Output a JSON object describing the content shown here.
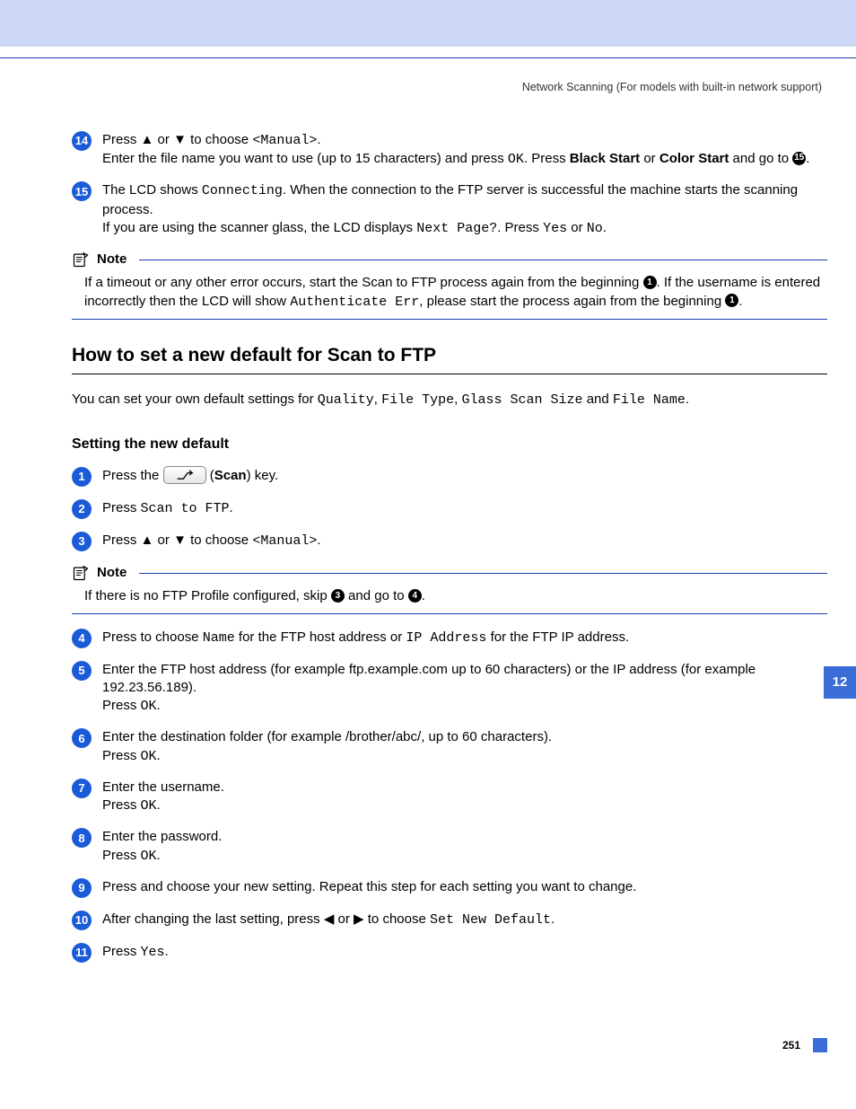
{
  "header": {
    "chapter_line": "Network Scanning (For models with built-in network support)"
  },
  "pre_steps": {
    "s14": {
      "num": "14",
      "t1a": "Press ",
      "t1b": " or ",
      "t1c": " to choose ",
      "t1_mono": "<Manual>",
      "t1d": ".",
      "t2a": "Enter the file name you want to use (up to 15 characters) and press ",
      "t2_mono": "OK",
      "t2b": ". Press ",
      "t2_bold1": "Black Start",
      "t2c": " or ",
      "t2_bold2": "Color Start",
      "t2d": " and go to ",
      "ref": "15",
      "t2e": "."
    },
    "s15": {
      "num": "15",
      "t1a": "The LCD shows ",
      "t1_mono": "Connecting",
      "t1b": ". When the connection to the FTP server is successful the machine starts the scanning process.",
      "t2a": "If you are using the scanner glass, the LCD displays ",
      "t2_mono1": "Next Page?",
      "t2b": ". Press ",
      "t2_mono2": "Yes",
      "t2c": " or ",
      "t2_mono3": "No",
      "t2d": "."
    }
  },
  "note1": {
    "title": "Note",
    "t1a": "If a timeout or any other error occurs, start the Scan to FTP process again from the beginning ",
    "ref1": "1",
    "t1b": ". If the username is entered incorrectly then the LCD will show ",
    "mono": "Authenticate Err",
    "t1c": ", please start the process again from the beginning ",
    "ref2": "1",
    "t1d": "."
  },
  "section": {
    "title": "How to set a new default for Scan to FTP",
    "intro_a": "You can set your own default settings for ",
    "m1": "Quality",
    "c1": ", ",
    "m2": "File Type",
    "c2": ", ",
    "m3": "Glass Scan Size",
    "c3": " and ",
    "m4": "File Name",
    "c4": "."
  },
  "subhead": "Setting the new default",
  "steps": {
    "s1": {
      "num": "1",
      "a": "Press the ",
      "b": " (",
      "bold": "Scan",
      "c": ") key."
    },
    "s2": {
      "num": "2",
      "a": "Press ",
      "mono": "Scan to FTP",
      "b": "."
    },
    "s3": {
      "num": "3",
      "a": "Press ",
      "b": " or ",
      "c": " to choose ",
      "mono": "<Manual>",
      "d": "."
    }
  },
  "note2": {
    "title": "Note",
    "a": "If there is no FTP Profile configured, skip ",
    "ref1": "3",
    "b": " and go to ",
    "ref2": "4",
    "c": "."
  },
  "steps2": {
    "s4": {
      "num": "4",
      "a": "Press to choose ",
      "m1": "Name",
      "b": " for the FTP host address or ",
      "m2": "IP Address",
      "c": " for the FTP IP address."
    },
    "s5": {
      "num": "5",
      "a": "Enter the FTP host address (for example ftp.example.com up to 60 characters) or the IP address (for example 192.23.56.189).",
      "b": "Press ",
      "mono": "OK",
      "c": "."
    },
    "s6": {
      "num": "6",
      "a": "Enter the destination folder (for example /brother/abc/, up to 60 characters).",
      "b": "Press ",
      "mono": "OK",
      "c": "."
    },
    "s7": {
      "num": "7",
      "a": "Enter the username.",
      "b": "Press ",
      "mono": "OK",
      "c": "."
    },
    "s8": {
      "num": "8",
      "a": "Enter the password.",
      "b": "Press ",
      "mono": "OK",
      "c": "."
    },
    "s9": {
      "num": "9",
      "a": "Press and choose your new setting. Repeat this step for each setting you want to change."
    },
    "s10": {
      "num": "10",
      "a": "After changing the last setting, press ",
      "b": " or ",
      "c": " to choose ",
      "mono": "Set New Default",
      "d": "."
    },
    "s11": {
      "num": "11",
      "a": "Press ",
      "mono": "Yes",
      "b": "."
    }
  },
  "side_tab": "12",
  "page_number": "251",
  "glyphs": {
    "up": "▲",
    "down": "▼",
    "left": "◀",
    "right": "▶"
  }
}
